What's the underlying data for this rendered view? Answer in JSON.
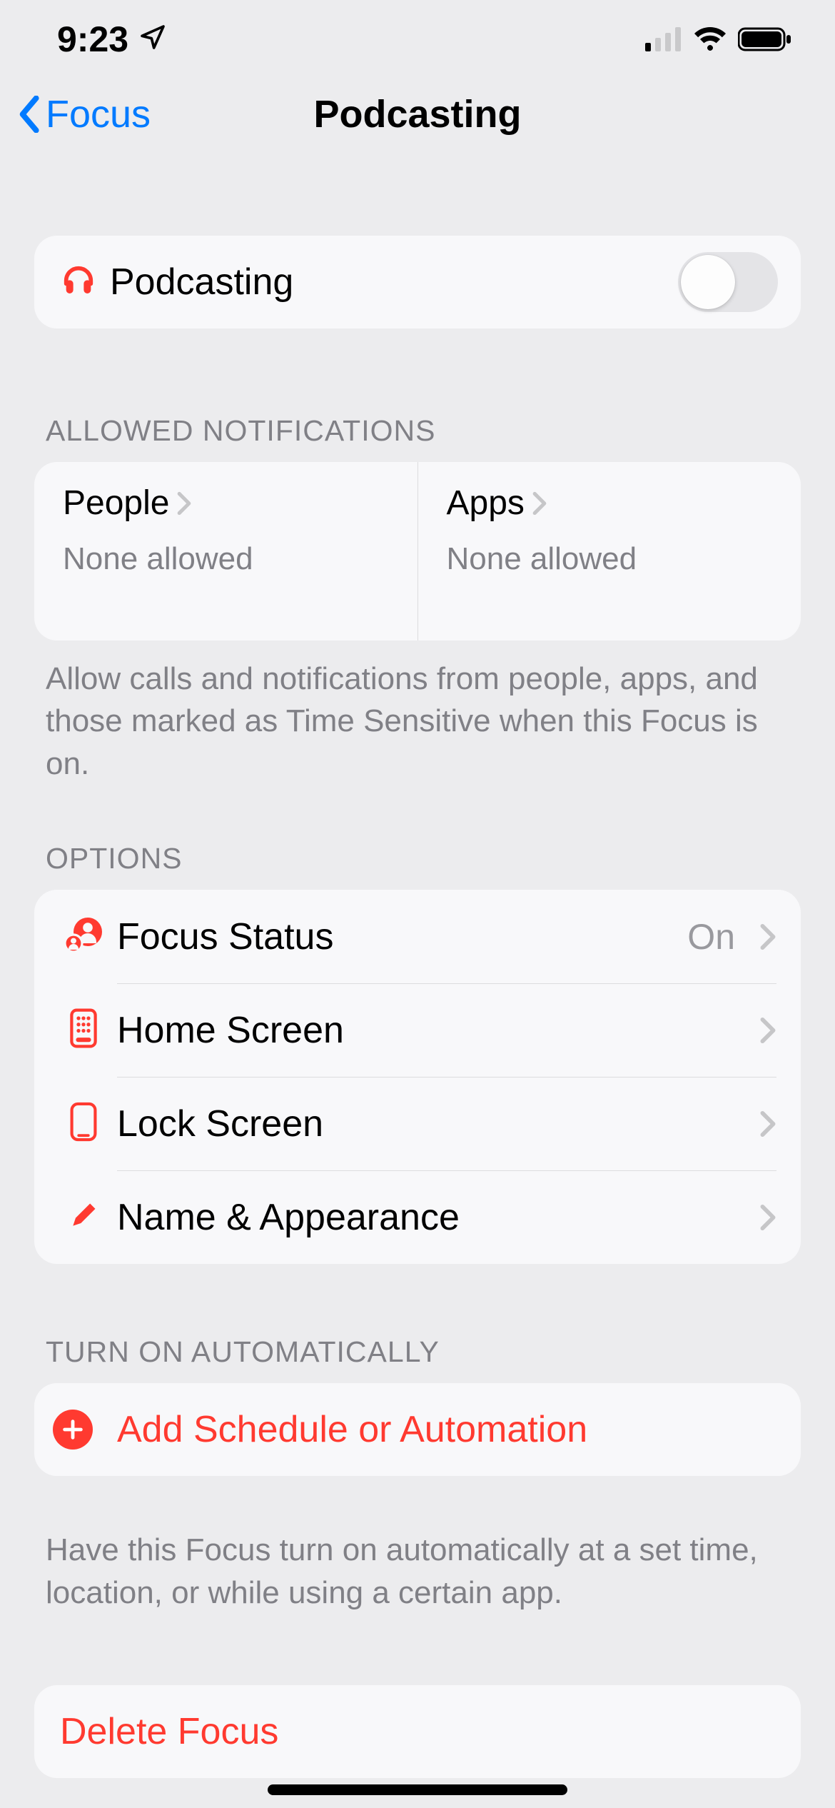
{
  "status": {
    "time": "9:23"
  },
  "nav": {
    "back_label": "Focus",
    "title": "Podcasting"
  },
  "toggle": {
    "label": "Podcasting",
    "on": false
  },
  "allowed": {
    "header": "ALLOWED NOTIFICATIONS",
    "people_label": "People",
    "people_value": "None allowed",
    "apps_label": "Apps",
    "apps_value": "None allowed",
    "footer": "Allow calls and notifications from people, apps, and those marked as Time Sensitive when this Focus is on."
  },
  "options": {
    "header": "OPTIONS",
    "rows": [
      {
        "label": "Focus Status",
        "value": "On"
      },
      {
        "label": "Home Screen",
        "value": ""
      },
      {
        "label": "Lock Screen",
        "value": ""
      },
      {
        "label": "Name & Appearance",
        "value": ""
      }
    ]
  },
  "automation": {
    "header": "TURN ON AUTOMATICALLY",
    "add_label": "Add Schedule or Automation",
    "footer": "Have this Focus turn on automatically at a set time, location, or while using a certain app."
  },
  "delete": {
    "label": "Delete Focus"
  },
  "colors": {
    "accent": "#ff3a30",
    "link": "#007aff"
  }
}
